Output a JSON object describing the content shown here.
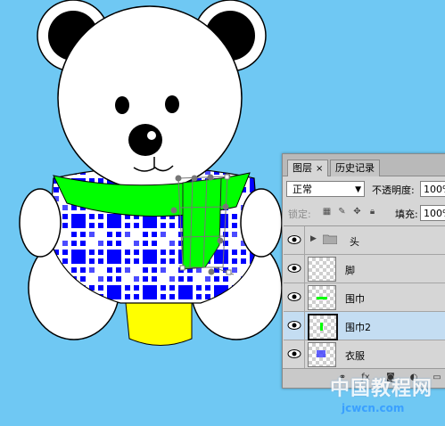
{
  "panel": {
    "tabs": [
      {
        "label": "图层",
        "close": "×"
      },
      {
        "label": "历史记录"
      }
    ],
    "blend_mode": "正常",
    "opacity_label": "不透明度:",
    "opacity_value": "100%",
    "lock_label": "锁定:",
    "fill_label": "填充:",
    "fill_value": "100%",
    "layers": [
      {
        "name": "头",
        "type": "group",
        "visible": true
      },
      {
        "name": "脚",
        "visible": true
      },
      {
        "name": "围巾",
        "visible": true
      },
      {
        "name": "围巾2",
        "visible": true,
        "selected": true
      },
      {
        "name": "衣服",
        "visible": true
      }
    ]
  },
  "watermark": {
    "text": "中国教程网",
    "sub": "jcwcn.com"
  },
  "colors": {
    "background": "#6fc8f3",
    "scarf": "#00ff00",
    "shirt_blue": "#0000ff",
    "pants": "#ffff00",
    "selected_layer": "#c4ddf2"
  }
}
